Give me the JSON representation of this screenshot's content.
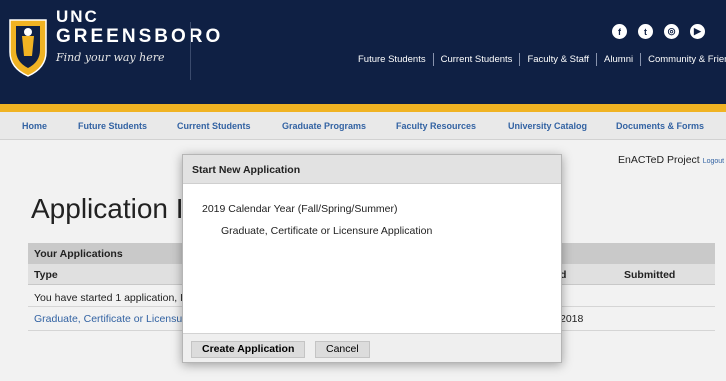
{
  "header": {
    "logo_unc": "UNC",
    "logo_greensboro": "GREENSBORO",
    "logo_tagline": "Find your way here",
    "audience_links": [
      "Future Students",
      "Current Students",
      "Faculty & Staff",
      "Alumni",
      "Community & Friends"
    ],
    "social_icons": [
      "facebook-icon",
      "twitter-icon",
      "instagram-icon",
      "youtube-icon"
    ],
    "social_glyphs": [
      "f",
      "t",
      "◎",
      "▶"
    ],
    "colors": {
      "navy": "#0f2044",
      "gold": "#f0b323",
      "link": "#3363a3"
    }
  },
  "subnav": {
    "items": [
      "Home",
      "Future Students",
      "Current Students",
      "Graduate Programs",
      "Faculty Resources",
      "University Catalog",
      "Documents & Forms"
    ]
  },
  "page": {
    "project": "EnACTeD Project",
    "logout": "Logout",
    "title": "Application I",
    "apps_section_title": "Your Applications",
    "col_type": "Type",
    "col_date": "d",
    "col_submitted": "Submitted",
    "row1_text": "You have started 1 application, I",
    "row2_link": "Graduate, Certificate or Licensu",
    "row2_date": "2018"
  },
  "modal": {
    "title": "Start New Application",
    "year": "2019 Calendar Year (Fall/Spring/Summer)",
    "app_type": "Graduate, Certificate or Licensure Application",
    "create_label": "Create Application",
    "cancel_label": "Cancel"
  }
}
